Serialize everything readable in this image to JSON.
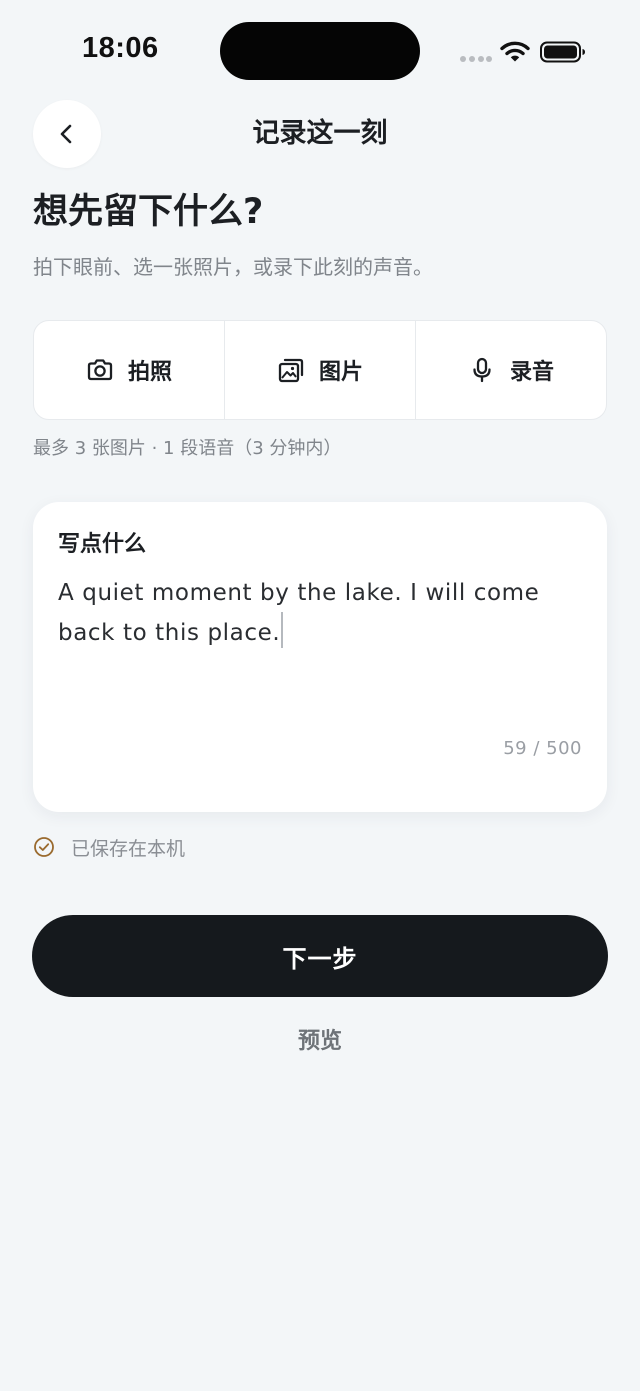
{
  "status_bar": {
    "time": "18:06"
  },
  "header": {
    "title": "记录这一刻"
  },
  "intro": {
    "headline": "想先留下什么?",
    "subheadline": "拍下眼前、选一张照片，或录下此刻的声音。"
  },
  "capture_options": [
    {
      "label": "拍照",
      "icon": "camera-icon"
    },
    {
      "label": "图片",
      "icon": "image-icon"
    },
    {
      "label": "录音",
      "icon": "microphone-icon"
    }
  ],
  "limits_note": "最多 3 张图片 · 1 段语音（3 分钟内）",
  "text_entry": {
    "label": "写点什么",
    "value": "A quiet moment by the lake. I will come back to this place.",
    "char_count": "59 / 500"
  },
  "saved_status": {
    "text": "已保存在本机",
    "icon": "check-circle-icon"
  },
  "actions": {
    "next_label": "下一步",
    "preview_label": "预览"
  },
  "colors": {
    "background": "#F3F6F8",
    "primary_button": "#15191D",
    "saved_accent": "#9A6A2E"
  }
}
